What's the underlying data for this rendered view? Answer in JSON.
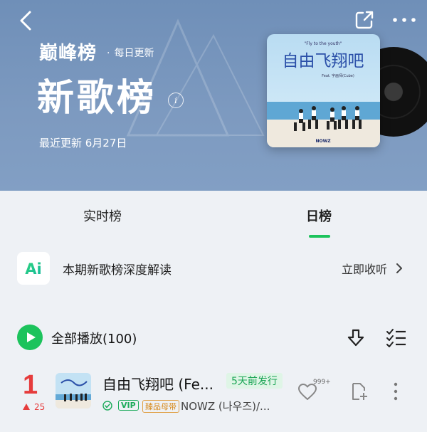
{
  "header": {
    "brand": "巅峰榜",
    "frequency": "每日更新",
    "dot": "·",
    "title": "新歌榜",
    "info": "i",
    "updated": "最近更新 6月27日",
    "cover": {
      "handwriting": "自由飞翔吧",
      "tagline": "\"Fly to the youth\"",
      "feat": "Feat. 宇画师(Cube)",
      "label": "NOWZ"
    }
  },
  "tabs": [
    {
      "label": "实时榜",
      "active": false
    },
    {
      "label": "日榜",
      "active": true
    }
  ],
  "ai_banner": {
    "logo": "Ai",
    "text": "本期新歌榜深度解读",
    "action": "立即收听"
  },
  "play_all": {
    "label": "全部播放",
    "count": "(100)"
  },
  "songs": [
    {
      "rank": "1",
      "rank_change": "25",
      "title": "自由飞翔吧 (Fe...",
      "badge": "5天前发行",
      "vip": "VIP",
      "quality": "臻品母带",
      "artist": "NOWZ (나우즈)/...",
      "likes": "999+"
    }
  ],
  "icons": {
    "back": "chevron-left-icon",
    "share": "share-icon",
    "more": "more-horizontal-icon",
    "download": "download-icon",
    "multi_select": "multi-select-icon",
    "heart": "heart-icon",
    "add": "add-to-playlist-icon",
    "song_more": "more-vertical-icon"
  },
  "colors": {
    "accent": "#1cc35c",
    "rank": "#e63c3c",
    "header_bg": "#7d9ac0"
  }
}
